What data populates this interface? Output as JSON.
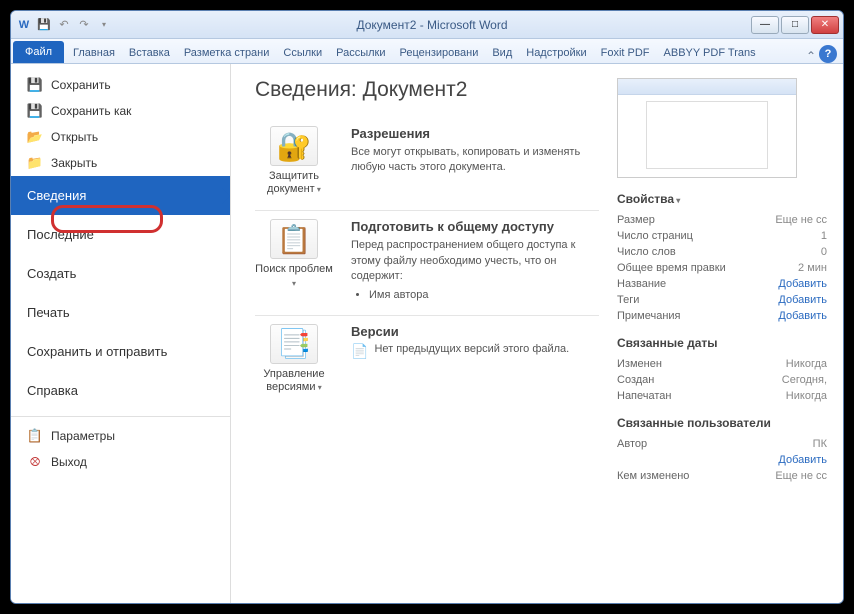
{
  "title": "Документ2 - Microsoft Word",
  "tabs": {
    "file": "Файл",
    "home": "Главная",
    "insert": "Вставка",
    "layout": "Разметка страни",
    "refs": "Ссылки",
    "mail": "Рассылки",
    "review": "Рецензировани",
    "view": "Вид",
    "addins": "Надстройки",
    "foxit": "Foxit PDF",
    "abbyy": "ABBYY PDF Trans"
  },
  "nav": {
    "save": "Сохранить",
    "saveas": "Сохранить как",
    "open": "Открыть",
    "close": "Закрыть",
    "info": "Сведения",
    "recent": "Последние",
    "new": "Создать",
    "print": "Печать",
    "share": "Сохранить и отправить",
    "help": "Справка",
    "options": "Параметры",
    "exit": "Выход"
  },
  "heading": "Сведения: Документ2",
  "perm": {
    "btn": "Защитить документ",
    "h": "Разрешения",
    "d": "Все могут открывать, копировать и изменять любую часть этого документа."
  },
  "prep": {
    "btn": "Поиск проблем",
    "h": "Подготовить к общему доступу",
    "d": "Перед распространением общего доступа к этому файлу необходимо учесть, что он содержит:",
    "li1": "Имя автора"
  },
  "vers": {
    "btn": "Управление версиями",
    "h": "Версии",
    "d": "Нет предыдущих версий этого файла."
  },
  "props": {
    "h": "Свойства",
    "size_k": "Размер",
    "size_v": "Еще не сс",
    "pages_k": "Число страниц",
    "pages_v": "1",
    "words_k": "Число слов",
    "words_v": "0",
    "time_k": "Общее время правки",
    "time_v": "2 мин",
    "title_k": "Название",
    "title_v": "Добавить",
    "tags_k": "Теги",
    "tags_v": "Добавить",
    "notes_k": "Примечания",
    "notes_v": "Добавить"
  },
  "dates": {
    "h": "Связанные даты",
    "mod_k": "Изменен",
    "mod_v": "Никогда",
    "cre_k": "Создан",
    "cre_v": "Сегодня,",
    "prn_k": "Напечатан",
    "prn_v": "Никогда"
  },
  "users": {
    "h": "Связанные пользователи",
    "auth_k": "Автор",
    "auth_v": "ПК",
    "add_v": "Добавить",
    "mod_k": "Кем изменено",
    "mod_v": "Еще не сс"
  }
}
